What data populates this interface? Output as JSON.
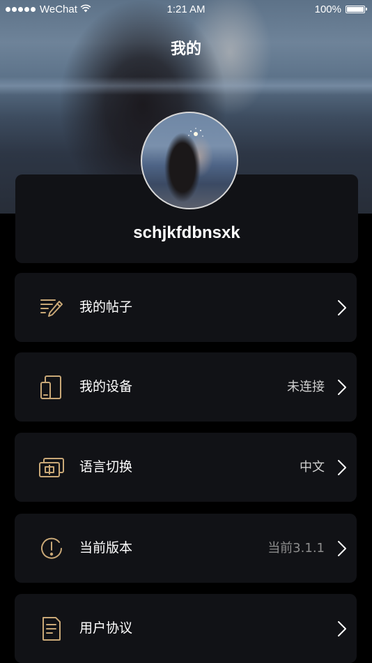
{
  "status_bar": {
    "carrier": "WeChat",
    "time": "1:21 AM",
    "battery": "100%"
  },
  "header": {
    "title": "我的"
  },
  "profile": {
    "username": "schjkfdbnsxk"
  },
  "menu": {
    "items": [
      {
        "label": "我的帖子",
        "value": "",
        "icon": "edit-posts-icon"
      },
      {
        "label": "我的设备",
        "value": "未连接",
        "icon": "device-icon"
      },
      {
        "label": "语言切换",
        "value": "中文",
        "icon": "language-switch-icon"
      },
      {
        "label": "当前版本",
        "value": "当前3.1.1",
        "icon": "info-icon"
      },
      {
        "label": "用户协议",
        "value": "",
        "icon": "document-icon"
      }
    ]
  },
  "colors": {
    "accent": "#c9a877",
    "card_background": "#111216",
    "page_background": "#000000"
  }
}
